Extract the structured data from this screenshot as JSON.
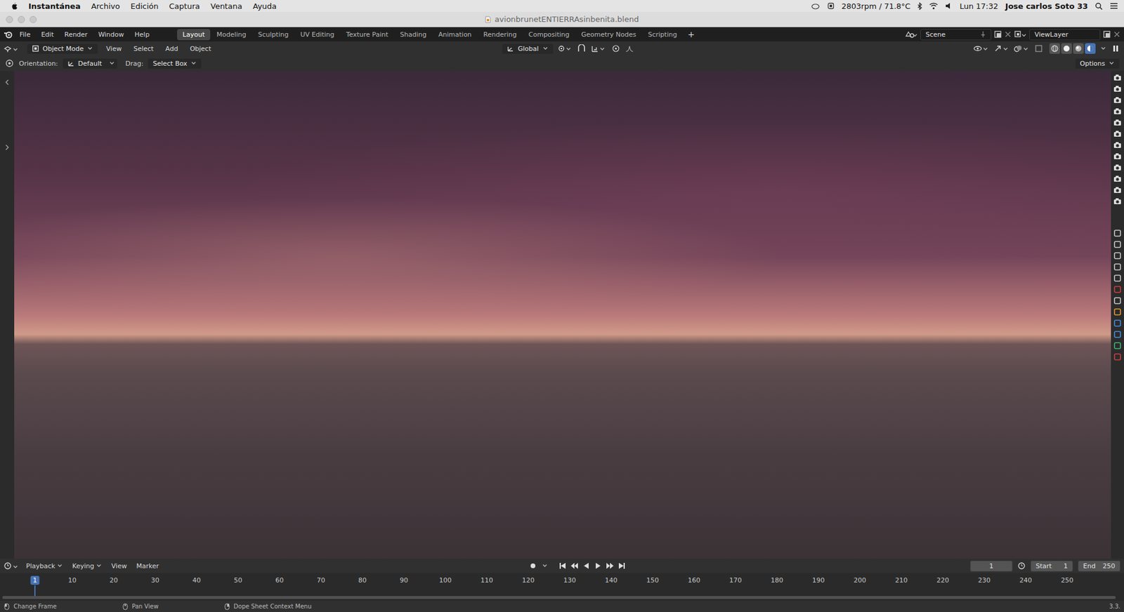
{
  "mac_menubar": {
    "app": "Instantánea",
    "items": [
      "Archivo",
      "Edición",
      "Captura",
      "Ventana",
      "Ayuda"
    ],
    "sensor": "2803rpm / 71.8°C",
    "clock": "Lun 17:32",
    "user": "Jose carlos Soto 33"
  },
  "window": {
    "title": "avionbrunetENTIERRAsinbenita.blend"
  },
  "topbar": {
    "menu": [
      "File",
      "Edit",
      "Render",
      "Window",
      "Help"
    ],
    "workspaces": [
      {
        "label": "Layout",
        "selected": true
      },
      {
        "label": "Modeling",
        "selected": false
      },
      {
        "label": "Sculpting",
        "selected": false
      },
      {
        "label": "UV Editing",
        "selected": false
      },
      {
        "label": "Texture Paint",
        "selected": false
      },
      {
        "label": "Shading",
        "selected": false
      },
      {
        "label": "Animation",
        "selected": false
      },
      {
        "label": "Rendering",
        "selected": false
      },
      {
        "label": "Compositing",
        "selected": false
      },
      {
        "label": "Geometry Nodes",
        "selected": false
      },
      {
        "label": "Scripting",
        "selected": false
      }
    ],
    "add_tab": "+",
    "scene": "Scene",
    "view_layer": "ViewLayer"
  },
  "header": {
    "mode": "Object Mode",
    "menu": [
      "View",
      "Select",
      "Add",
      "Object"
    ],
    "transform": "Global",
    "shading": [
      {
        "kind": "wireframe",
        "selected": false
      },
      {
        "kind": "solid",
        "selected": false
      },
      {
        "kind": "material",
        "selected": false
      },
      {
        "kind": "rendered",
        "selected": true
      }
    ]
  },
  "tool_settings": {
    "orientation_label": "Orientation:",
    "orientation": "Default",
    "drag_label": "Drag:",
    "drag": "Select Box",
    "options": "Options"
  },
  "timeline": {
    "menu": [
      "Playback",
      "Keying",
      "View",
      "Marker"
    ],
    "current_frame": "1",
    "start_label": "Start",
    "start": "1",
    "end_label": "End",
    "end": "250",
    "ticks": [
      {
        "label": "1",
        "selected": true
      },
      {
        "label": "10",
        "selected": false
      },
      {
        "label": "20",
        "selected": false
      },
      {
        "label": "30",
        "selected": false
      },
      {
        "label": "40",
        "selected": false
      },
      {
        "label": "50",
        "selected": false
      },
      {
        "label": "60",
        "selected": false
      },
      {
        "label": "70",
        "selected": false
      },
      {
        "label": "80",
        "selected": false
      },
      {
        "label": "90",
        "selected": false
      },
      {
        "label": "100",
        "selected": false
      },
      {
        "label": "110",
        "selected": false
      },
      {
        "label": "120",
        "selected": false
      },
      {
        "label": "130",
        "selected": false
      },
      {
        "label": "140",
        "selected": false
      },
      {
        "label": "150",
        "selected": false
      },
      {
        "label": "160",
        "selected": false
      },
      {
        "label": "170",
        "selected": false
      },
      {
        "label": "180",
        "selected": false
      },
      {
        "label": "190",
        "selected": false
      },
      {
        "label": "200",
        "selected": false
      },
      {
        "label": "210",
        "selected": false
      },
      {
        "label": "220",
        "selected": false
      },
      {
        "label": "230",
        "selected": false
      },
      {
        "label": "240",
        "selected": false
      },
      {
        "label": "250",
        "selected": false
      }
    ]
  },
  "status_bar": {
    "hints": [
      "Change Frame",
      "Pan View",
      "Dope Sheet Context Menu"
    ],
    "version": "3.3."
  }
}
